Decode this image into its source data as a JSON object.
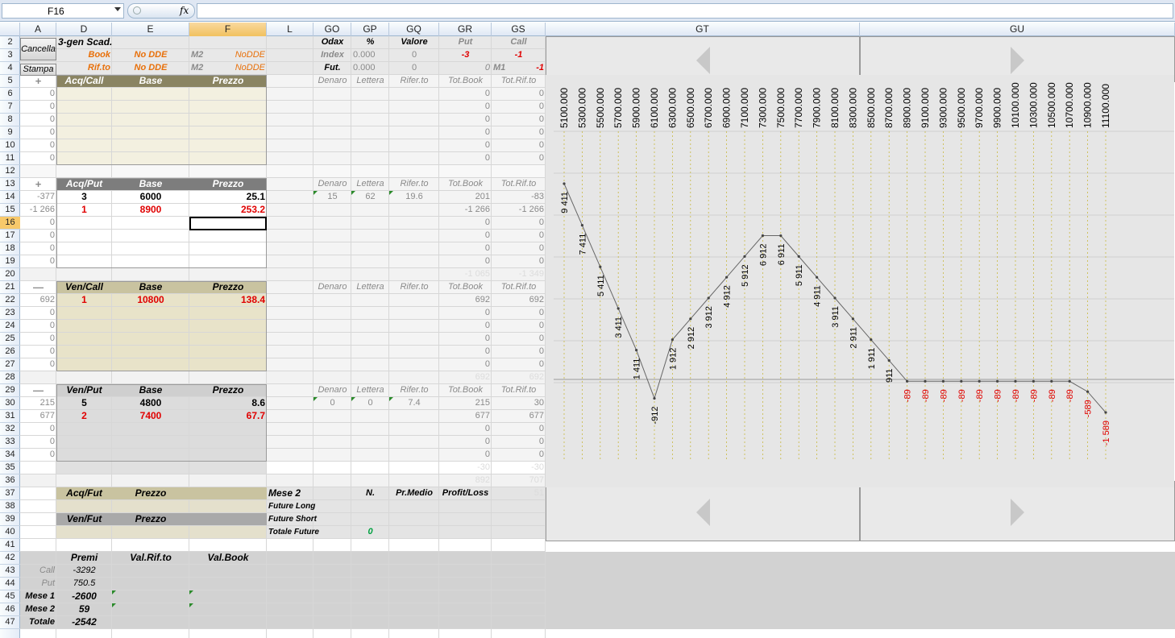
{
  "formula_bar": {
    "name_box": "F16",
    "fx": "fx",
    "formula": ""
  },
  "columns": [
    {
      "id": "A",
      "label": "A"
    },
    {
      "id": "D",
      "label": "D"
    },
    {
      "id": "E",
      "label": "E"
    },
    {
      "id": "F",
      "label": "F"
    },
    {
      "id": "L",
      "label": "L"
    },
    {
      "id": "GO",
      "label": "GO"
    },
    {
      "id": "GP",
      "label": "GP"
    },
    {
      "id": "GQ",
      "label": "GQ"
    },
    {
      "id": "GR",
      "label": "GR"
    },
    {
      "id": "GS",
      "label": "GS"
    },
    {
      "id": "GT",
      "label": "GT"
    },
    {
      "id": "GU",
      "label": "GU"
    }
  ],
  "rows": [
    "2",
    "3",
    "4",
    "5",
    "6",
    "7",
    "8",
    "9",
    "10",
    "11",
    "12",
    "13",
    "14",
    "15",
    "16",
    "17",
    "18",
    "19",
    "20",
    "21",
    "22",
    "23",
    "24",
    "25",
    "26",
    "27",
    "28",
    "29",
    "30",
    "31",
    "32",
    "33",
    "34",
    "35",
    "36",
    "37",
    "38",
    "39",
    "40",
    "41",
    "42",
    "43",
    "44",
    "45",
    "46",
    "47"
  ],
  "selected_cell": "F16",
  "buttons": {
    "cancella": "Cancella",
    "stampa": "Stampa"
  },
  "header_block": {
    "title": "3-gen Scad.",
    "book": "Book",
    "rif": "Rif.to",
    "no_dde": "No DDE",
    "m2": "M2",
    "nodde": "NoDDE",
    "odax": "Odax",
    "pct": "%",
    "valore": "Valore",
    "put": "Put",
    "call": "Call",
    "index": "Index",
    "index_pct": "0.000",
    "index_val": "0",
    "put_val": "-3",
    "call_val": "-1",
    "fut": "Fut.",
    "fut_pct": "0.000",
    "fut_val": "0",
    "m1": "M1",
    "m1_val": "-1"
  },
  "col_labels": {
    "denaro": "Denaro",
    "lettera": "Lettera",
    "rifer": "Rifer.to",
    "totbook": "Tot.Book",
    "totrif": "Tot.Rif.to"
  },
  "sections": {
    "acq_call": {
      "title": "Acq/Call",
      "base": "Base",
      "prezzo": "Prezzo",
      "sign": "+"
    },
    "acq_put": {
      "title": "Acq/Put",
      "base": "Base",
      "prezzo": "Prezzo",
      "sign": "+"
    },
    "ven_call": {
      "title": "Ven/Call",
      "base": "Base",
      "prezzo": "Prezzo",
      "sign": "—"
    },
    "ven_put": {
      "title": "Ven/Put",
      "base": "Base",
      "prezzo": "Prezzo",
      "sign": "—"
    }
  },
  "acq_call_rows": [
    {
      "a": "0",
      "gr": "0",
      "gs": "0"
    },
    {
      "a": "0",
      "gr": "0",
      "gs": "0"
    },
    {
      "a": "0",
      "gr": "0",
      "gs": "0"
    },
    {
      "a": "0",
      "gr": "0",
      "gs": "0"
    },
    {
      "a": "0",
      "gr": "0",
      "gs": "0"
    },
    {
      "a": "0",
      "gr": "0",
      "gs": "0"
    }
  ],
  "acq_put_rows": [
    {
      "a": "-377",
      "d": "3",
      "e": "6000",
      "f": "25.1",
      "go": "15",
      "gp": "62",
      "gq": "19.6",
      "gr": "201",
      "gs": "-83",
      "red": false
    },
    {
      "a": "-1 266",
      "d": "1",
      "e": "8900",
      "f": "253.2",
      "go": "",
      "gp": "",
      "gq": "",
      "gr": "-1 266",
      "gs": "-1 266",
      "red": true
    },
    {
      "a": "0",
      "gr": "0",
      "gs": "0"
    },
    {
      "a": "0",
      "gr": "0",
      "gs": "0"
    },
    {
      "a": "0",
      "gr": "0",
      "gs": "0"
    },
    {
      "a": "0",
      "gr": "0",
      "gs": "0"
    }
  ],
  "row20": {
    "gr": "-1 065",
    "gs": "-1 349"
  },
  "ven_call_rows": [
    {
      "a": "692",
      "d": "1",
      "e": "10800",
      "f": "138.4",
      "gr": "692",
      "gs": "692",
      "red": true
    },
    {
      "a": "0",
      "gr": "0",
      "gs": "0"
    },
    {
      "a": "0",
      "gr": "0",
      "gs": "0"
    },
    {
      "a": "0",
      "gr": "0",
      "gs": "0"
    },
    {
      "a": "0",
      "gr": "0",
      "gs": "0"
    },
    {
      "a": "0",
      "gr": "0",
      "gs": "0"
    }
  ],
  "row28": {
    "gr": "692",
    "gs": "692"
  },
  "ven_put_rows": [
    {
      "a": "215",
      "d": "5",
      "e": "4800",
      "f": "8.6",
      "go": "0",
      "gp": "0",
      "gq": "7.4",
      "gr": "215",
      "gs": "30",
      "red": false
    },
    {
      "a": "677",
      "d": "2",
      "e": "7400",
      "f": "67.7",
      "gr": "677",
      "gs": "677",
      "red": true
    },
    {
      "a": "0",
      "gr": "0",
      "gs": "0"
    },
    {
      "a": "0",
      "gr": "0",
      "gs": "0"
    },
    {
      "a": "0",
      "gr": "0",
      "gs": "0"
    }
  ],
  "row35": {
    "gr": "-30",
    "gs": "-30"
  },
  "row36": {
    "gr": "892",
    "gs": "707"
  },
  "futures": {
    "acq_fut": "Acq/Fut",
    "ven_fut": "Ven/Fut",
    "prezzo": "Prezzo",
    "mese2": "Mese 2",
    "n": "N.",
    "pr_medio": "Pr.Medio",
    "profit_loss": "Profit/Loss",
    "pl_val": "51",
    "future_long": "Future Long",
    "future_short": "Future Short",
    "totale_future": "Totale Future",
    "totale_val": "0"
  },
  "summary": {
    "premi": "Premi",
    "val_rif": "Val.Rif.to",
    "val_book": "Val.Book",
    "rows": [
      {
        "label": "Call",
        "premi": "-3292"
      },
      {
        "label": "Put",
        "premi": "750.5"
      },
      {
        "label": "Mese 1",
        "premi": "-2600"
      },
      {
        "label": "Mese 2",
        "premi": "59"
      },
      {
        "label": "Totale",
        "premi": "-2542"
      }
    ]
  },
  "chart_data": {
    "type": "line",
    "categories": [
      "5100.000",
      "5300.000",
      "5500.000",
      "5700.000",
      "5900.000",
      "6100.000",
      "6300.000",
      "6500.000",
      "6700.000",
      "6900.000",
      "7100.000",
      "7300.000",
      "7500.000",
      "7700.000",
      "7900.000",
      "8100.000",
      "8300.000",
      "8500.000",
      "8700.000",
      "8900.000",
      "9100.000",
      "9300.000",
      "9500.000",
      "9700.000",
      "9900.000",
      "10100.000",
      "10300.000",
      "10500.000",
      "10700.000",
      "10900.000",
      "11100.000"
    ],
    "values": [
      9411,
      7411,
      5411,
      3411,
      1411,
      -912,
      1912,
      2912,
      3912,
      4912,
      5912,
      6912,
      6911,
      5911,
      4911,
      3911,
      2911,
      1911,
      911,
      -89,
      -89,
      -89,
      -89,
      -89,
      -89,
      -89,
      -89,
      -89,
      -89,
      -589,
      -1589
    ],
    "point_labels": [
      "9 411",
      "7 411",
      "5 411",
      "3 411",
      "1 411",
      "-912",
      "1 912",
      "2 912",
      "3 912",
      "4 912",
      "5 912",
      "6 912",
      "6 911",
      "5 911",
      "4 911",
      "3 911",
      "2 911",
      "1 911",
      "911",
      "-89",
      "-89",
      "-89",
      "-89",
      "-89",
      "-89",
      "-89",
      "-89",
      "-89",
      "-89",
      "-589",
      "-1 589"
    ],
    "negative_color": "#e00000",
    "positive_color": "#000000"
  }
}
